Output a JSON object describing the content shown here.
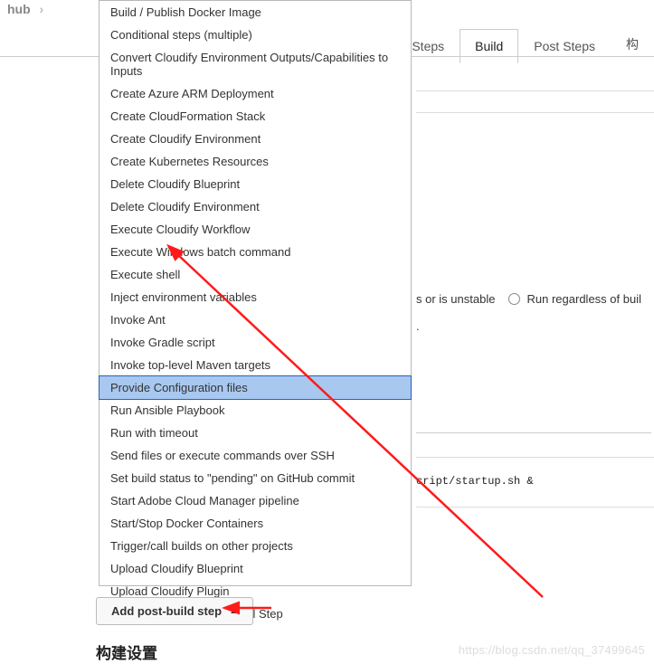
{
  "breadcrumb": {
    "item": "hub"
  },
  "tabs": {
    "pre": "Pre Steps",
    "build": "Build",
    "post": "Post Steps",
    "extra": "构"
  },
  "dropdown": {
    "items": [
      "Build / Publish Docker Image",
      "Conditional steps (multiple)",
      "Convert Cloudify Environment Outputs/Capabilities to Inputs",
      "Create Azure ARM Deployment",
      "Create CloudFormation Stack",
      "Create Cloudify Environment",
      "Create Kubernetes Resources",
      "Delete Cloudify Blueprint",
      "Delete Cloudify Environment",
      "Execute Cloudify Workflow",
      "Execute Windows batch command",
      "Execute shell",
      "Inject environment variables",
      "Invoke Ant",
      "Invoke Gradle script",
      "Invoke top-level Maven targets",
      "Provide Configuration files",
      "Run Ansible Playbook",
      "Run with timeout",
      "Send files or execute commands over SSH",
      "Set build status to \"pending\" on GitHub commit",
      "Start Adobe Cloud Manager pipeline",
      "Start/Stop Docker Containers",
      "Trigger/call builds on other projects",
      "Upload Cloudify Blueprint",
      "Upload Cloudify Plugin",
      "[Experimental] Docker Shell Step"
    ],
    "highlight_index": 16
  },
  "fragments": {
    "unstable": "s or is unstable",
    "run_regardless": "Run regardless of buil",
    "dot_line": ".",
    "script_path": "cript/startup.sh &"
  },
  "button": {
    "add_post_build": "Add post-build step"
  },
  "section": {
    "build_settings": "构建设置"
  },
  "watermark": "https://blog.csdn.net/qq_37499645"
}
